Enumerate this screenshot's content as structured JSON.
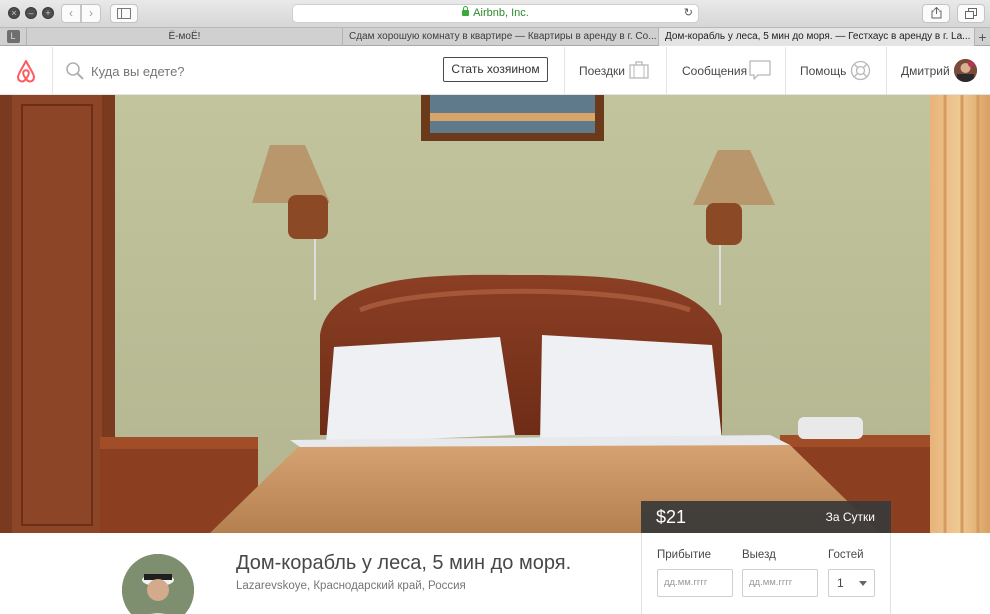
{
  "browser": {
    "url_text": "Airbnb, Inc.",
    "tabs": [
      {
        "label": "Ё-моЁ!"
      },
      {
        "label": "Сдам хорошую комнату в квартире — Квартиры в аренду в г. Со..."
      },
      {
        "label": "Дом-корабль у леса, 5 мин до моря. — Гестхаус в аренду в г. La..."
      }
    ],
    "pinned_tab": "L"
  },
  "header": {
    "search_placeholder": "Куда вы едете?",
    "host_button": "Стать хозяином",
    "trips": "Поездки",
    "messages": "Сообщения",
    "help": "Помощь",
    "user_name": "Дмитрий",
    "brand_color": "#FF5A5F"
  },
  "booking": {
    "price": "$21",
    "per": "За Сутки",
    "checkin_label": "Прибытие",
    "checkout_label": "Выезд",
    "guests_label": "Гостей",
    "checkin_placeholder": "дд.мм.гггг",
    "checkout_placeholder": "дд.мм.гггг",
    "guests_value": "1"
  },
  "listing": {
    "title": "Дом-корабль у леса, 5 мин до моря.",
    "location": "Lazarevskoye, Краснодарский край, Россия"
  }
}
